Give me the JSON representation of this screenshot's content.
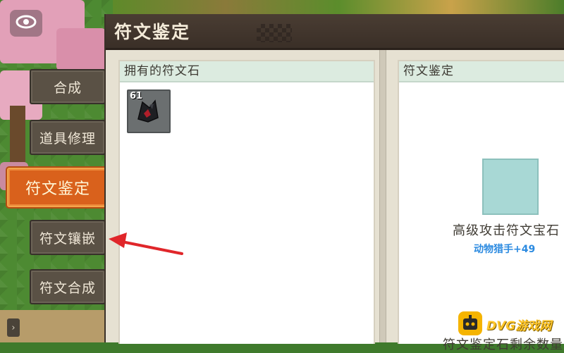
{
  "window": {
    "title": "符文鉴定"
  },
  "nav": {
    "items": [
      {
        "label": "合成"
      },
      {
        "label": "道具修理"
      },
      {
        "label": "符文鉴定"
      },
      {
        "label": "符文镶嵌"
      },
      {
        "label": "符文合成"
      }
    ],
    "active_index": 2
  },
  "inventory": {
    "header": "拥有的符文石",
    "items": [
      {
        "count": "61",
        "icon": "dark-rune-stone-icon"
      }
    ]
  },
  "identify": {
    "header": "符文鉴定",
    "gem_name": "高级攻击符文宝石",
    "gem_attribute": "动物猎手+49",
    "remaining_label": "符文鉴定石剩余数量"
  },
  "watermark": {
    "text": "DVG游戏网"
  },
  "colors": {
    "active_tab": "#d9611c",
    "attribute_text": "#2b8ae0",
    "annotation_arrow": "#e0262a",
    "preview_slot": "#a8d8d5"
  }
}
